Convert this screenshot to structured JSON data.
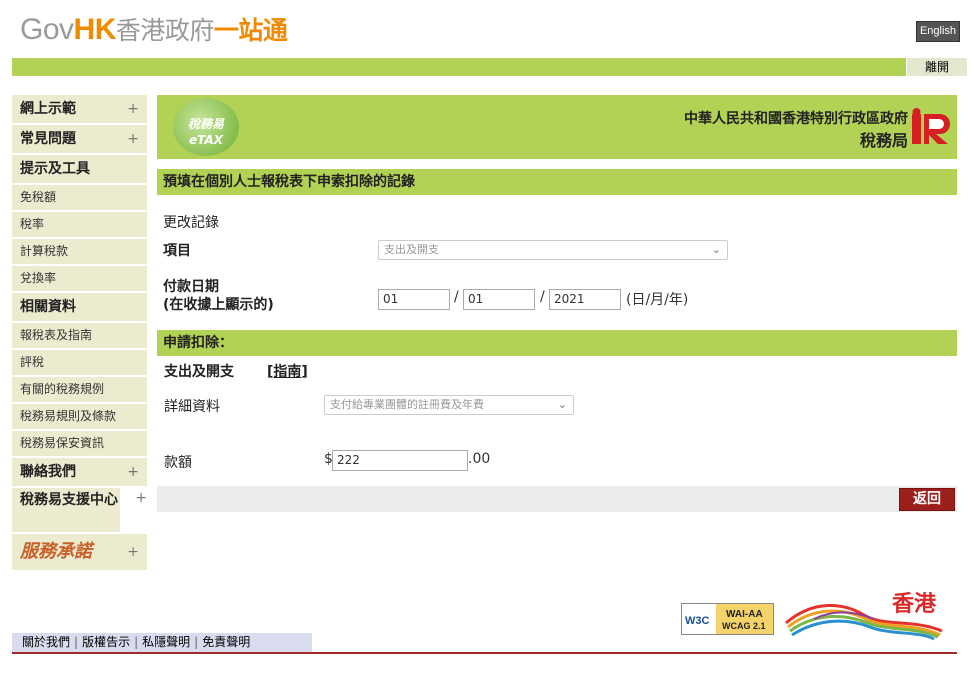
{
  "header": {
    "logo_gov": "Gov",
    "logo_hk": "HK",
    "logo_cn": "香港政府",
    "logo_one": "一站通",
    "lang_button": "English",
    "logout": "離開"
  },
  "sidebar": {
    "items": [
      {
        "label": "網上示範",
        "type": "head",
        "plus": "+"
      },
      {
        "label": "常見問題",
        "type": "head",
        "plus": "+"
      },
      {
        "label": "提示及工具",
        "type": "head"
      },
      {
        "label": "免稅額",
        "type": "link"
      },
      {
        "label": "稅率",
        "type": "link"
      },
      {
        "label": "計算稅款",
        "type": "link"
      },
      {
        "label": "兌換率",
        "type": "link"
      },
      {
        "label": "相關資料",
        "type": "head"
      },
      {
        "label": "報稅表及指南",
        "type": "link"
      },
      {
        "label": "評稅",
        "type": "link"
      },
      {
        "label": "有關的稅務規例",
        "type": "link"
      },
      {
        "label": "稅務易規則及條款",
        "type": "link"
      },
      {
        "label": "稅務易保安資訊",
        "type": "link"
      },
      {
        "label": "聯絡我們",
        "type": "head",
        "plus": "+"
      },
      {
        "label": "稅務易支援中心",
        "type": "head",
        "plus": "+"
      },
      {
        "label": "服務承諾",
        "type": "serv",
        "plus": "+"
      }
    ]
  },
  "banner": {
    "etax_cn": "稅務易",
    "etax_en": "eTAX",
    "dept_line1": "中華人民共和國香港特別行政區政府",
    "dept_line2": "稅務局"
  },
  "form": {
    "title": "預填在個別人士報稅表下申索扣除的記錄",
    "edit_record": "更改記錄",
    "item_label": "項目",
    "item_value": "支出及開支",
    "date_label_1": "付款日期",
    "date_label_2": "(在收據上顯示的)",
    "date_day": "01",
    "date_month": "01",
    "date_year": "2021",
    "date_sep": "/",
    "date_format": "(日/月/年)",
    "claim_heading": "申請扣除：",
    "section_title": "支出及開支",
    "guide_open": "[",
    "guide_link": "指南",
    "guide_close": "]",
    "detail_label": "詳細資料",
    "detail_value": "支付給專業團體的註冊費及年費",
    "amount_label": "款額",
    "currency": "$",
    "amount_value": "222",
    "cents": ".00",
    "back_button": "返回"
  },
  "footer": {
    "links": [
      "關於我們",
      "版權告示",
      "私隱聲明",
      "免責聲明"
    ],
    "link_sep": "|",
    "w3c_text": "W3C",
    "wai_line1": "WAI-AA",
    "wai_line2": "WCAG 2.1",
    "hk_brand": "香港"
  },
  "colors": {
    "accent_green": "#b2d255",
    "brand_orange": "#f08a00",
    "back_red": "#9b1f1a"
  }
}
